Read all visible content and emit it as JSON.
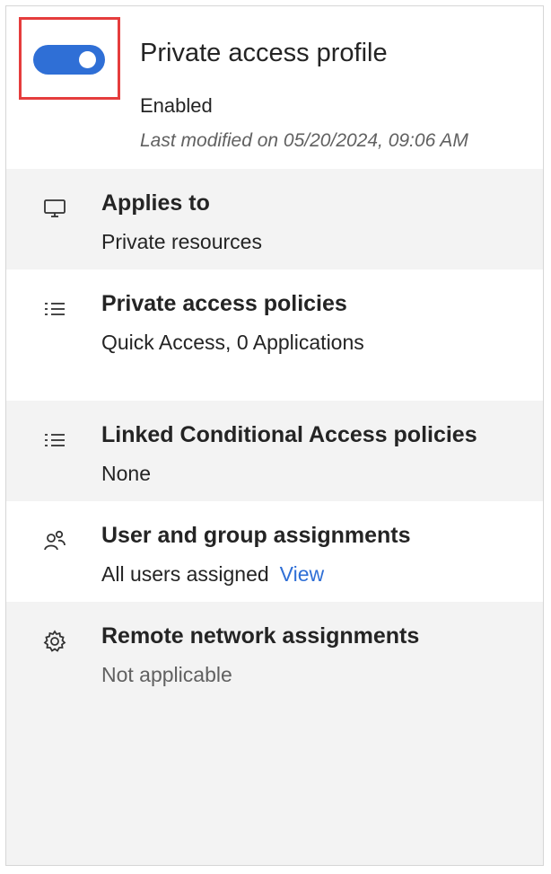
{
  "profile": {
    "title": "Private access profile",
    "status": "Enabled",
    "last_modified": "Last modified on 05/20/2024, 09:06 AM",
    "toggle_state": "on"
  },
  "sections": [
    {
      "icon": "monitor-icon",
      "title": "Applies to",
      "value": "Private resources"
    },
    {
      "icon": "list-icon",
      "title": "Private access policies",
      "value": "Quick Access, 0 Applications"
    },
    {
      "icon": "list-icon",
      "title": "Linked Conditional Access policies",
      "value": "None"
    },
    {
      "icon": "people-icon",
      "title": "User and group assignments",
      "value": "All users assigned",
      "link": "View"
    },
    {
      "icon": "gear-icon",
      "title": "Remote network assignments",
      "value": "Not applicable"
    }
  ],
  "colors": {
    "accent": "#2f6fd6",
    "highlight": "#e53d3d",
    "panel_grey": "#f3f3f3"
  }
}
